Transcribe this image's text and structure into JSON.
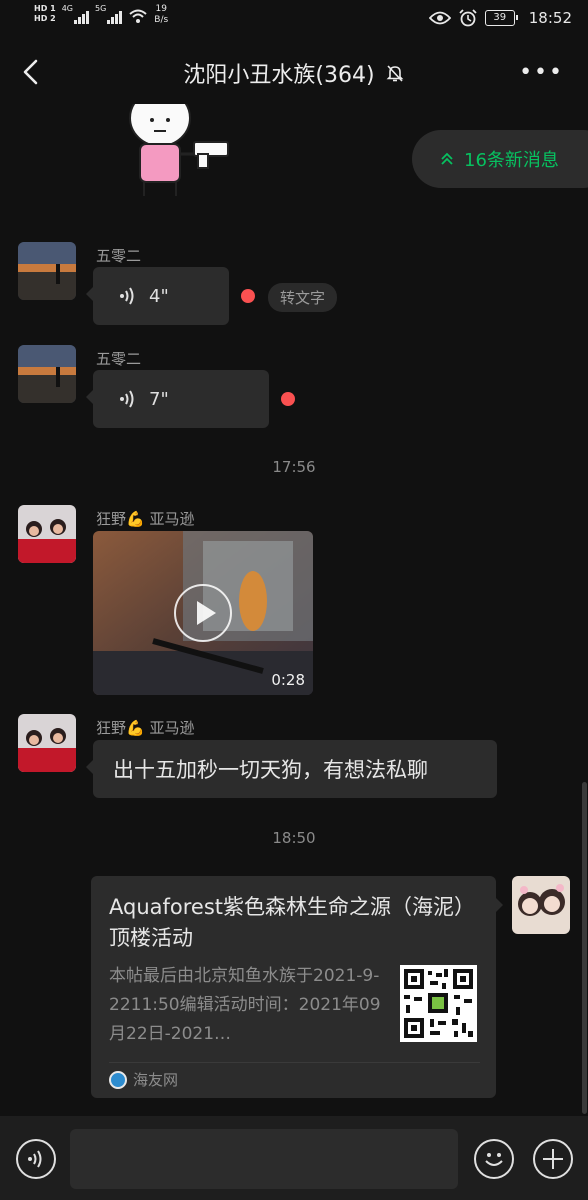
{
  "status_bar": {
    "sim1": "HD 1",
    "sim2": "HD 2",
    "net1": "4G",
    "net2": "5G",
    "speed_value": "19",
    "speed_unit": "B/s",
    "battery": "39",
    "time": "18:52"
  },
  "header": {
    "title": "沈阳小丑水族(364)"
  },
  "new_messages": {
    "label": "16条新消息"
  },
  "messages": [
    {
      "sender": "五零二",
      "voice_duration": "4\"",
      "to_text": "转文字"
    },
    {
      "sender": "五零二",
      "voice_duration": "7\""
    },
    {
      "time": "17:56"
    },
    {
      "sender": "狂野💪 亚马逊",
      "video_duration": "0:28"
    },
    {
      "sender": "狂野💪 亚马逊",
      "text": "出十五加秒一切天狗，有想法私聊"
    },
    {
      "time": "18:50"
    },
    {
      "card_title": "Aquaforest紫色森林生命之源（海泥）顶楼活动",
      "card_desc": "本帖最后由北京知鱼水族于2021-9-2211:50编辑活动时间：2021年09月22日-2021…",
      "card_source": "海友网"
    }
  ],
  "colors": {
    "background": "#111111",
    "bubble": "#2c2c2c",
    "accent_green": "#07c160",
    "unread_red": "#fa5151"
  }
}
